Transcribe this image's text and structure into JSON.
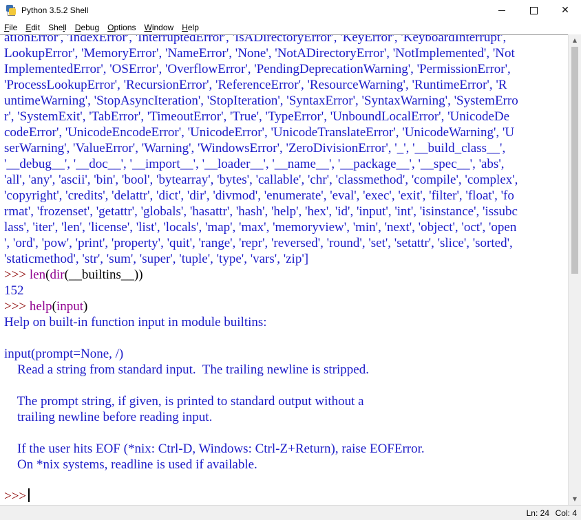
{
  "window": {
    "title": "Python 3.5.2 Shell"
  },
  "menu": [
    {
      "label": "File",
      "key": "F",
      "rest": "ile"
    },
    {
      "label": "Edit",
      "key": "E",
      "rest": "dit"
    },
    {
      "label": "Shell",
      "pre": "She",
      "key": "l",
      "rest": "l"
    },
    {
      "label": "Debug",
      "key": "D",
      "rest": "ebug"
    },
    {
      "label": "Options",
      "key": "O",
      "rest": "ptions"
    },
    {
      "label": "Window",
      "key": "W",
      "rest": "indow"
    },
    {
      "label": "Help",
      "key": "H",
      "rest": "elp"
    }
  ],
  "shell": {
    "dir_output": [
      "ationError', 'IndexError', 'InterruptedError', 'IsADirectoryError', 'KeyError', 'KeyboardInterrupt',",
      "LookupError', 'MemoryError', 'NameError', 'None', 'NotADirectoryError', 'NotImplemented', 'Not",
      "ImplementedError', 'OSError', 'OverflowError', 'PendingDeprecationWarning', 'PermissionError',",
      "'ProcessLookupError', 'RecursionError', 'ReferenceError', 'ResourceWarning', 'RuntimeError', 'R",
      "untimeWarning', 'StopAsyncIteration', 'StopIteration', 'SyntaxError', 'SyntaxWarning', 'SystemErro",
      "r', 'SystemExit', 'TabError', 'TimeoutError', 'True', 'TypeError', 'UnboundLocalError', 'UnicodeDe",
      "codeError', 'UnicodeEncodeError', 'UnicodeError', 'UnicodeTranslateError', 'UnicodeWarning', 'U",
      "serWarning', 'ValueError', 'Warning', 'WindowsError', 'ZeroDivisionError', '_', '__build_class__',",
      "'__debug__', '__doc__', '__import__', '__loader__', '__name__', '__package__', '__spec__', 'abs',",
      "'all', 'any', 'ascii', 'bin', 'bool', 'bytearray', 'bytes', 'callable', 'chr', 'classmethod', 'compile', 'complex',",
      "'copyright', 'credits', 'delattr', 'dict', 'dir', 'divmod', 'enumerate', 'eval', 'exec', 'exit', 'filter', 'float', 'fo",
      "rmat', 'frozenset', 'getattr', 'globals', 'hasattr', 'hash', 'help', 'hex', 'id', 'input', 'int', 'isinstance', 'issubc",
      "lass', 'iter', 'len', 'license', 'list', 'locals', 'map', 'max', 'memoryview', 'min', 'next', 'object', 'oct', 'open",
      "', 'ord', 'pow', 'print', 'property', 'quit', 'range', 'repr', 'reversed', 'round', 'set', 'setattr', 'slice', 'sorted',",
      "'staticmethod', 'str', 'sum', 'super', 'tuple', 'type', 'vars', 'zip']"
    ],
    "prompt": ">>> ",
    "cmd1": {
      "fn1": "len",
      "open1": "(",
      "fn2": "dir",
      "rest": "(__builtins__))"
    },
    "result1": "152",
    "cmd2": {
      "fn": "help",
      "open": "(",
      "arg": "input",
      "close": ")"
    },
    "help_output": [
      "Help on built-in function input in module builtins:",
      "",
      "input(prompt=None, /)",
      "    Read a string from standard input.  The trailing newline is stripped.",
      "",
      "    The prompt string, if given, is printed to standard output without a",
      "    trailing newline before reading input.",
      "",
      "    If the user hits EOF (*nix: Ctrl-D, Windows: Ctrl-Z+Return), raise EOFError.",
      "    On *nix systems, readline is used if available.",
      ""
    ],
    "final_prompt": ">>>"
  },
  "status": {
    "line": "Ln: 24",
    "col": "Col: 4"
  },
  "colors": {
    "output": "#1c1cc8",
    "prompt": "#8b0000",
    "builtin": "#900090",
    "input": "#000000"
  },
  "icons": [
    "python-shell-icon",
    "minimize-icon",
    "maximize-icon",
    "close-icon",
    "scroll-up-icon",
    "scroll-down-icon"
  ]
}
